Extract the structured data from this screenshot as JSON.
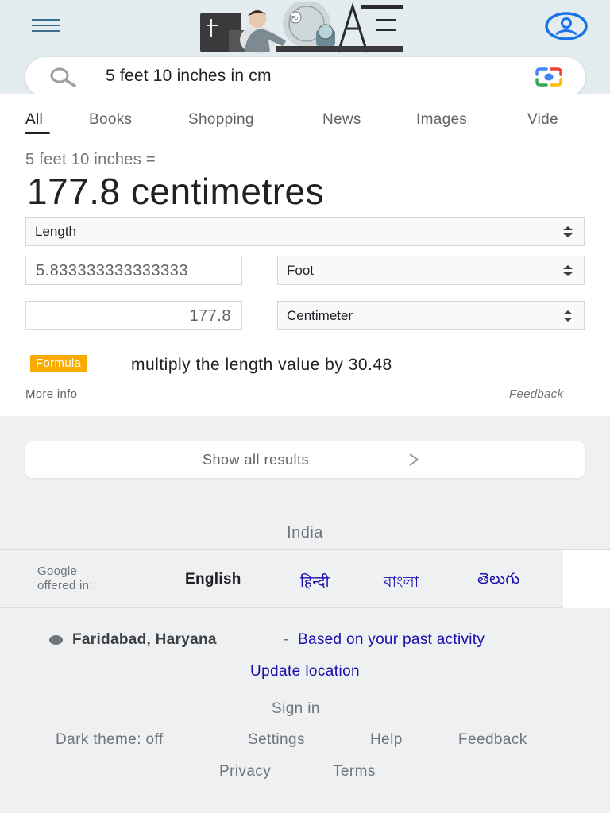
{
  "search": {
    "query": "5 feet 10 inches in cm"
  },
  "tabs": [
    "All",
    "Books",
    "Shopping",
    "News",
    "Images",
    "Vide"
  ],
  "converter": {
    "equation": "5 feet 10 inches =",
    "result": "177.8 centimetres",
    "unit_type": "Length",
    "input_value": "5.833333333333333",
    "input_unit": "Foot",
    "output_value": "177.8",
    "output_unit": "Centimeter",
    "formula_badge": "Formula",
    "formula_text": "multiply the length value by 30.48",
    "more_info": "More info",
    "feedback": "Feedback"
  },
  "show_all": {
    "label": "Show all results",
    "chevron": ">"
  },
  "footer": {
    "country": "India",
    "offered_in_line1": "Google",
    "offered_in_line2": "offered in:",
    "languages": [
      "English",
      "हिन्दी",
      "বাংলা",
      "తెలుగు"
    ],
    "location_city": "Faridabad, Haryana",
    "location_dash": "-",
    "location_basis": "Based on your past activity",
    "update_location": "Update location",
    "sign_in": "Sign in",
    "dark_theme": "Dark theme: off",
    "settings": "Settings",
    "help": "Help",
    "feedback": "Feedback",
    "privacy": "Privacy",
    "terms": "Terms"
  },
  "icons": {
    "menu": "hamburger-menu-icon",
    "account": "account-circle-icon",
    "search": "magnifier-icon",
    "lens": "google-lens-camera-icon",
    "doodle": "google-doodle-image"
  },
  "colors": {
    "header_bg": "#e3edf0",
    "link": "#1a0dab",
    "formula_badge": "#f9ab00",
    "account_icon": "#1a73e8"
  }
}
